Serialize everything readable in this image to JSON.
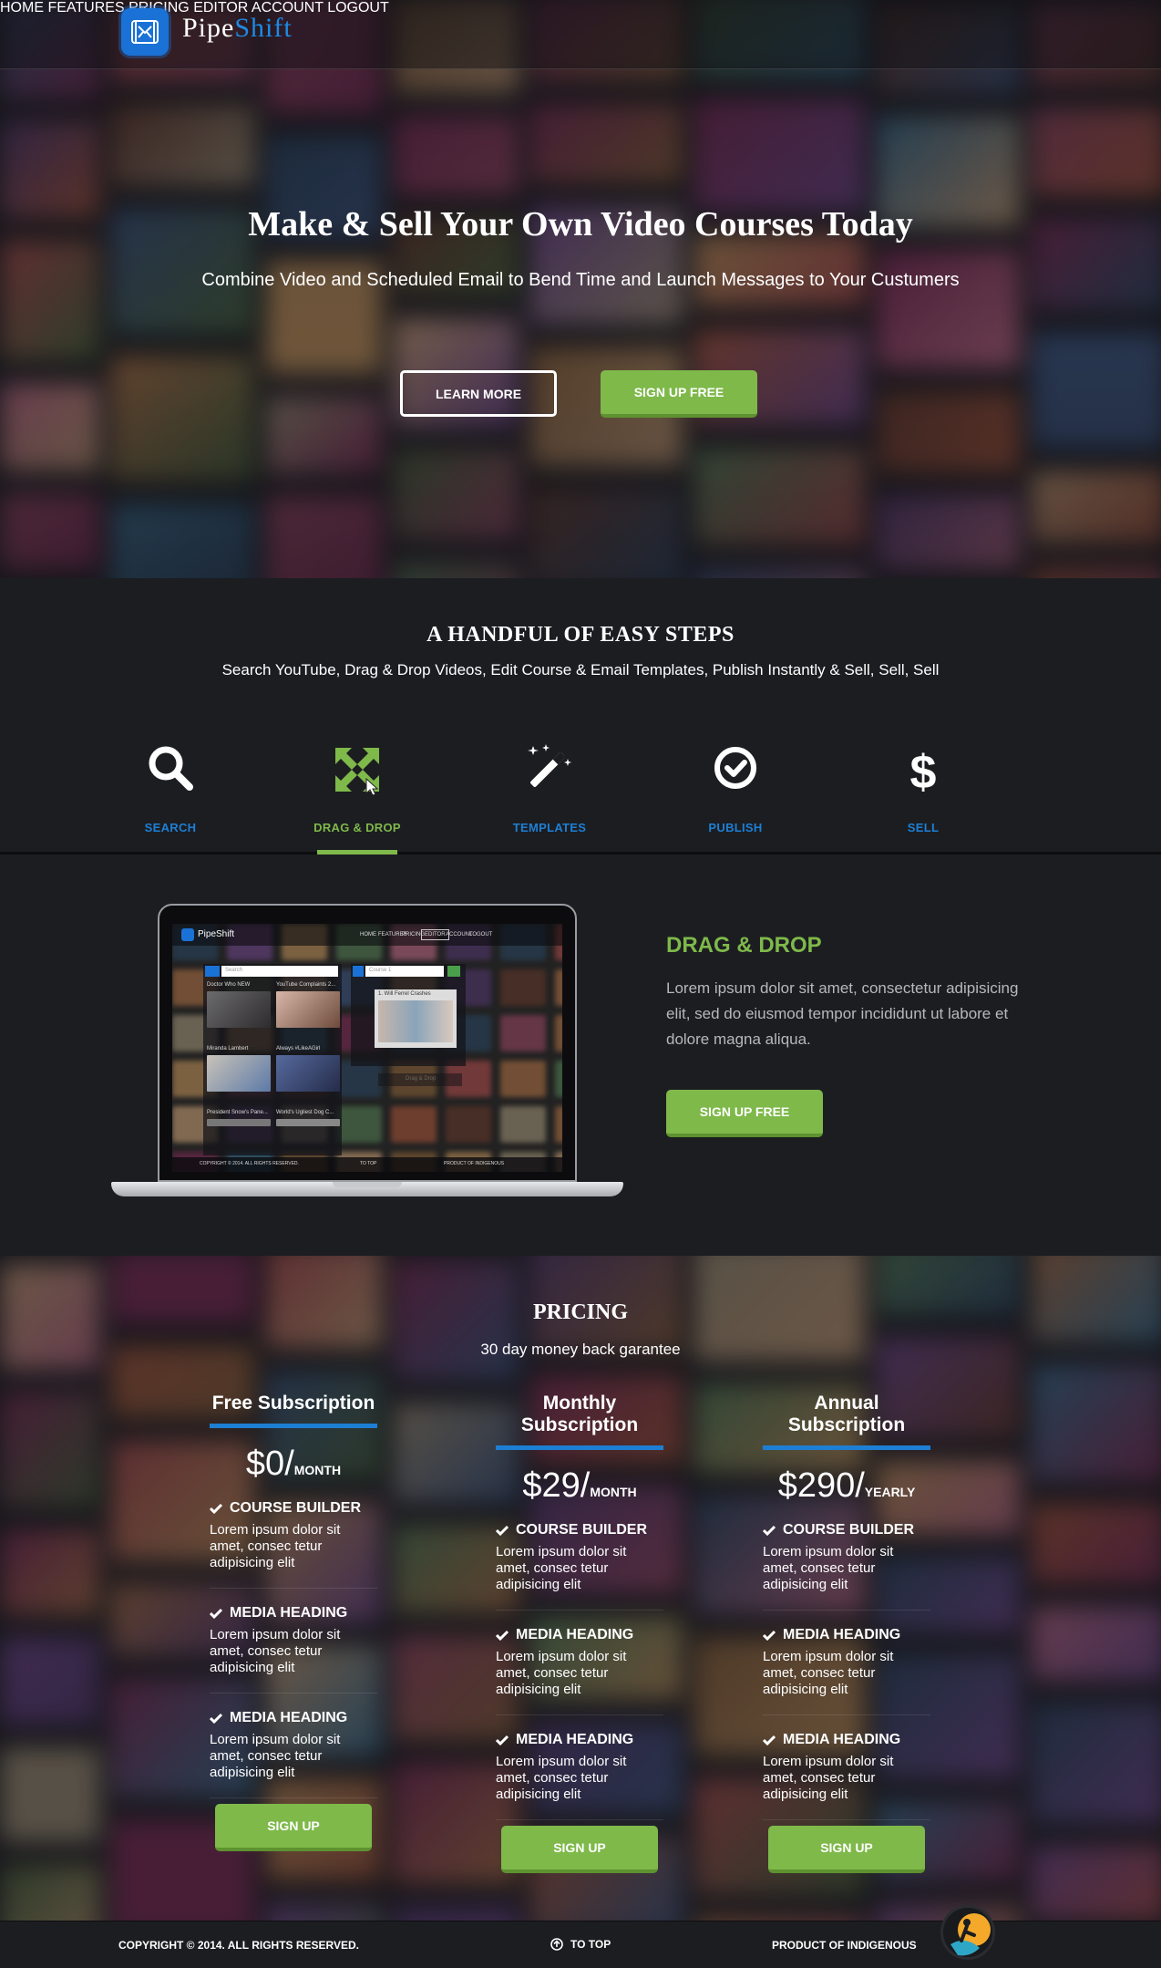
{
  "brand": {
    "name_part1": "Pipe",
    "name_part2": "Shift",
    "accent": "#1a72d6",
    "green": "#7eb94a"
  },
  "nav": {
    "items": [
      "HOME",
      "FEATURES",
      "PRICING",
      "EDITOR",
      "ACCOUNT",
      "LOGOUT"
    ]
  },
  "hero": {
    "title": "Make & Sell Your Own Video Courses Today",
    "subtitle": "Combine Video and Scheduled Email to Bend Time and Launch Messages to Your Custumers",
    "learn_more": "LEARN MORE",
    "signup": "SIGN UP FREE"
  },
  "steps": {
    "title": "A HANDFUL OF EASY STEPS",
    "subtitle": "Search YouTube, Drag & Drop Videos, Edit Course & Email Templates, Publish Instantly & Sell, Sell, Sell",
    "items": [
      {
        "label": "SEARCH",
        "icon": "search-icon"
      },
      {
        "label": "DRAG & DROP",
        "icon": "drag-drop-icon",
        "active": true
      },
      {
        "label": "TEMPLATES",
        "icon": "magic-wand-icon"
      },
      {
        "label": "PUBLISH",
        "icon": "check-circle-icon"
      },
      {
        "label": "SELL",
        "icon": "dollar-icon"
      }
    ]
  },
  "feature": {
    "title": "DRAG & DROP",
    "text": "Lorem ipsum dolor sit amet, consectetur adipisicing elit, sed do eiusmod tempor incididunt ut labore et dolore magna aliqua.",
    "signup": "SIGN UP FREE"
  },
  "pricing": {
    "title": "PRICING",
    "subtitle": "30 day money back garantee",
    "plans": [
      {
        "name": "Free Subscription",
        "amount": "$0/",
        "period": "MONTH",
        "features": [
          {
            "heading": "COURSE BUILDER",
            "text": "Lorem ipsum dolor sit amet, consec tetur adipisicing elit"
          },
          {
            "heading": "MEDIA HEADING",
            "text": "Lorem ipsum dolor sit amet, consec tetur adipisicing elit"
          },
          {
            "heading": "MEDIA HEADING",
            "text": "Lorem ipsum dolor sit amet, consec tetur adipisicing elit"
          }
        ],
        "signup": "SIGN UP"
      },
      {
        "name": "Monthly Subscription",
        "amount": "$29/",
        "period": "MONTH",
        "features": [
          {
            "heading": "COURSE BUILDER",
            "text": "Lorem ipsum dolor sit amet, consec tetur adipisicing elit"
          },
          {
            "heading": "MEDIA HEADING",
            "text": "Lorem ipsum dolor sit amet, consec tetur adipisicing elit"
          },
          {
            "heading": "MEDIA HEADING",
            "text": "Lorem ipsum dolor sit amet, consec tetur adipisicing elit"
          }
        ],
        "signup": "SIGN UP"
      },
      {
        "name": "Annual Subscription",
        "amount": "$290/",
        "period": "YEARLY",
        "features": [
          {
            "heading": "COURSE BUILDER",
            "text": "Lorem ipsum dolor sit amet, consec tetur adipisicing elit"
          },
          {
            "heading": "MEDIA HEADING",
            "text": "Lorem ipsum dolor sit amet, consec tetur adipisicing elit"
          },
          {
            "heading": "MEDIA HEADING",
            "text": "Lorem ipsum dolor sit amet, consec tetur adipisicing elit"
          }
        ],
        "signup": "SIGN UP"
      }
    ]
  },
  "footer": {
    "copyright": "COPYRIGHT © 2014.  ALL RIGHTS RESERVED.",
    "to_top": "TO TOP",
    "product_of": "PRODUCT OF INDIGENOUS"
  },
  "laptop_screen": {
    "brand": "PipeShift",
    "nav": [
      "HOME",
      "FEATURES",
      "PRICING",
      "EDITOR",
      "ACCOUNT",
      "LOGOUT"
    ],
    "search_placeholder": "Search",
    "course_select": "Course 1",
    "videos": [
      "Doctor Who NEW",
      "YouTube Complaints 2...",
      "Miranda Lambert",
      "Always #LikeAGirl",
      "President Snow's Pane...",
      "World's Ugliest Dog C..."
    ],
    "lesson": "1. Will Ferrel Crashes",
    "drop_hint": "Drag & Drop",
    "footer_left": "COPYRIGHT © 2014.  ALL RIGHTS RESERVED.",
    "footer_mid": "TO TOP",
    "footer_right": "PRODUCT OF INDIGENOUS"
  }
}
